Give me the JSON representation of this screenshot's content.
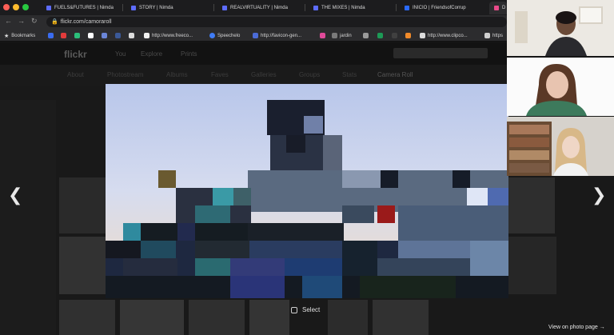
{
  "tabs": [
    {
      "title": "FUELS&FUTURES | Nimda"
    },
    {
      "title": "STORY | Nimda"
    },
    {
      "title": "REALVIRTUALITY | Nimda"
    },
    {
      "title": "THE MIXES | Nimda"
    },
    {
      "title": "INICIO | FriendsofCorrup"
    },
    {
      "title": "D"
    }
  ],
  "address": {
    "url": "flickr.com/camoraroll"
  },
  "bookmarks": [
    {
      "label": "Bookmarks"
    },
    {
      "label": "http://www.freeco..."
    },
    {
      "label": "Speechelo"
    },
    {
      "label": "http://favicon-gen..."
    },
    {
      "label": "jardin"
    },
    {
      "label": "http://www.clipco..."
    },
    {
      "label": "https"
    }
  ],
  "flickr": {
    "logo": "flickr",
    "nav": [
      "You",
      "Explore",
      "Prints"
    ],
    "subnav": [
      "About",
      "Photostream",
      "Albums",
      "Faves",
      "Galleries",
      "Groups",
      "Stats",
      "Camera Roll"
    ]
  },
  "lightbox": {
    "select_label": "Select",
    "view_link": "View on photo page →",
    "prev_icon": "chevron-left-icon",
    "next_icon": "chevron-right-icon"
  },
  "video_call": {
    "participants": 3
  }
}
